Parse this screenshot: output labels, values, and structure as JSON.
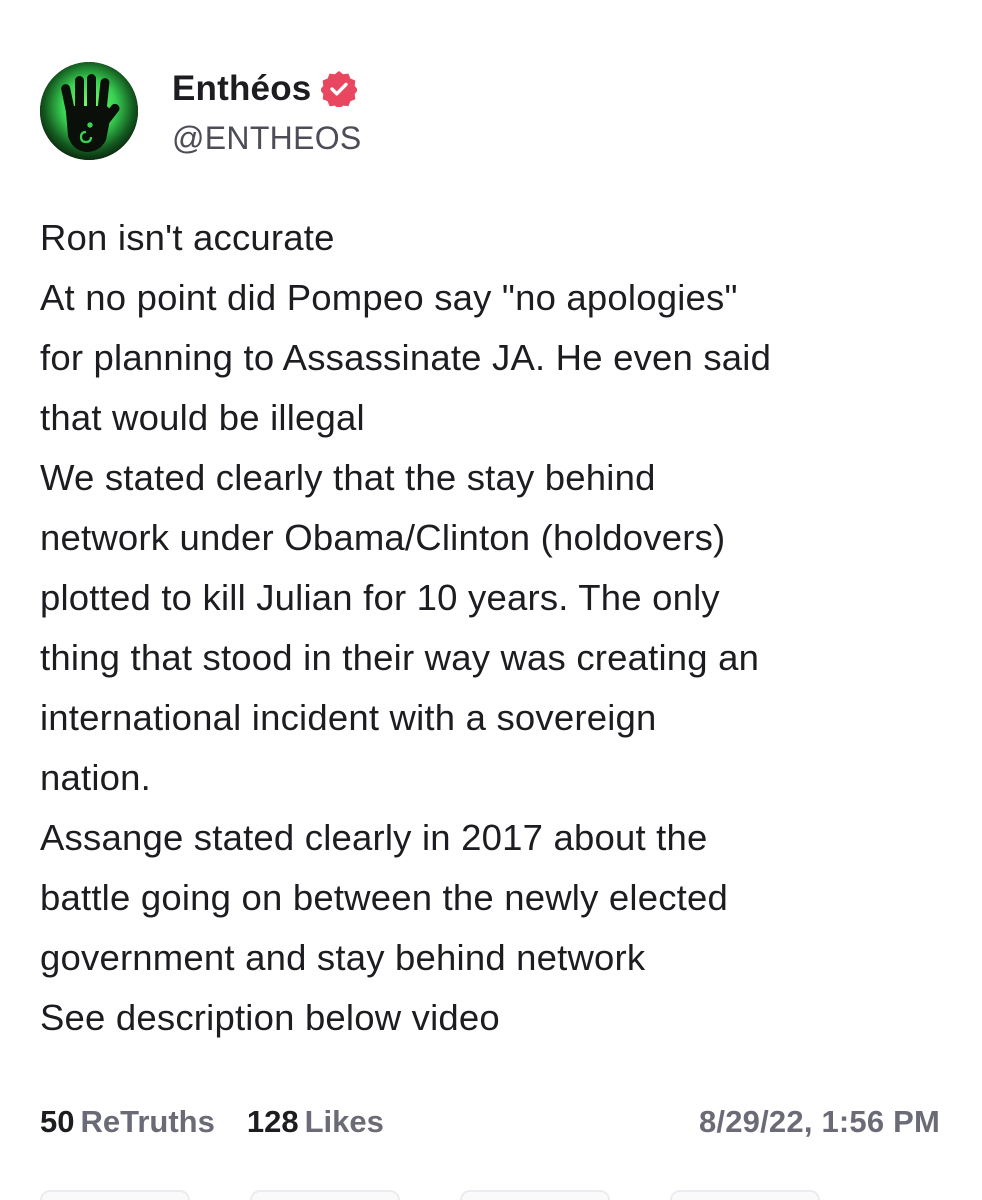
{
  "post": {
    "author": {
      "display_name": "Enthéos",
      "handle": "@ENTHEOS",
      "verified": true,
      "avatar_icon": "green-glowing-hand-avatar",
      "verified_icon": "verified-badge-icon"
    },
    "text_lines": [
      "Ron isn't accurate",
      "At no point did Pompeo say \"no apologies\"",
      "for planning to Assassinate JA. He even said",
      "that would be illegal",
      "We stated clearly that the stay behind",
      "network under Obama/Clinton (holdovers)",
      "plotted to kill Julian for 10 years. The only",
      "thing that stood in their way was creating an",
      "international incident with a sovereign",
      "nation.",
      "Assange stated clearly in 2017 about the",
      "battle going on between the newly elected",
      "government and stay behind network",
      "See description below video"
    ],
    "stats": {
      "retruths_count": "50",
      "retruths_label": "ReTruths",
      "likes_count": "128",
      "likes_label": "Likes"
    },
    "timestamp": "8/29/22, 1:56 PM"
  },
  "colors": {
    "text_primary": "#1c1c21",
    "text_secondary": "#6b6b78",
    "verified_badge": "#e8475f",
    "avatar_glow": "#39d353",
    "background": "#ffffff"
  }
}
